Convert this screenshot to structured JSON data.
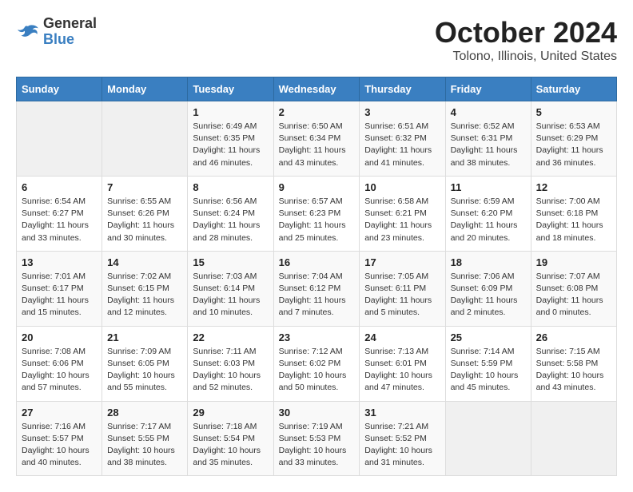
{
  "logo": {
    "general": "General",
    "blue": "Blue"
  },
  "title": "October 2024",
  "subtitle": "Tolono, Illinois, United States",
  "days_of_week": [
    "Sunday",
    "Monday",
    "Tuesday",
    "Wednesday",
    "Thursday",
    "Friday",
    "Saturday"
  ],
  "weeks": [
    [
      {
        "day": "",
        "info": ""
      },
      {
        "day": "",
        "info": ""
      },
      {
        "day": "1",
        "info": "Sunrise: 6:49 AM\nSunset: 6:35 PM\nDaylight: 11 hours and 46 minutes."
      },
      {
        "day": "2",
        "info": "Sunrise: 6:50 AM\nSunset: 6:34 PM\nDaylight: 11 hours and 43 minutes."
      },
      {
        "day": "3",
        "info": "Sunrise: 6:51 AM\nSunset: 6:32 PM\nDaylight: 11 hours and 41 minutes."
      },
      {
        "day": "4",
        "info": "Sunrise: 6:52 AM\nSunset: 6:31 PM\nDaylight: 11 hours and 38 minutes."
      },
      {
        "day": "5",
        "info": "Sunrise: 6:53 AM\nSunset: 6:29 PM\nDaylight: 11 hours and 36 minutes."
      }
    ],
    [
      {
        "day": "6",
        "info": "Sunrise: 6:54 AM\nSunset: 6:27 PM\nDaylight: 11 hours and 33 minutes."
      },
      {
        "day": "7",
        "info": "Sunrise: 6:55 AM\nSunset: 6:26 PM\nDaylight: 11 hours and 30 minutes."
      },
      {
        "day": "8",
        "info": "Sunrise: 6:56 AM\nSunset: 6:24 PM\nDaylight: 11 hours and 28 minutes."
      },
      {
        "day": "9",
        "info": "Sunrise: 6:57 AM\nSunset: 6:23 PM\nDaylight: 11 hours and 25 minutes."
      },
      {
        "day": "10",
        "info": "Sunrise: 6:58 AM\nSunset: 6:21 PM\nDaylight: 11 hours and 23 minutes."
      },
      {
        "day": "11",
        "info": "Sunrise: 6:59 AM\nSunset: 6:20 PM\nDaylight: 11 hours and 20 minutes."
      },
      {
        "day": "12",
        "info": "Sunrise: 7:00 AM\nSunset: 6:18 PM\nDaylight: 11 hours and 18 minutes."
      }
    ],
    [
      {
        "day": "13",
        "info": "Sunrise: 7:01 AM\nSunset: 6:17 PM\nDaylight: 11 hours and 15 minutes."
      },
      {
        "day": "14",
        "info": "Sunrise: 7:02 AM\nSunset: 6:15 PM\nDaylight: 11 hours and 12 minutes."
      },
      {
        "day": "15",
        "info": "Sunrise: 7:03 AM\nSunset: 6:14 PM\nDaylight: 11 hours and 10 minutes."
      },
      {
        "day": "16",
        "info": "Sunrise: 7:04 AM\nSunset: 6:12 PM\nDaylight: 11 hours and 7 minutes."
      },
      {
        "day": "17",
        "info": "Sunrise: 7:05 AM\nSunset: 6:11 PM\nDaylight: 11 hours and 5 minutes."
      },
      {
        "day": "18",
        "info": "Sunrise: 7:06 AM\nSunset: 6:09 PM\nDaylight: 11 hours and 2 minutes."
      },
      {
        "day": "19",
        "info": "Sunrise: 7:07 AM\nSunset: 6:08 PM\nDaylight: 11 hours and 0 minutes."
      }
    ],
    [
      {
        "day": "20",
        "info": "Sunrise: 7:08 AM\nSunset: 6:06 PM\nDaylight: 10 hours and 57 minutes."
      },
      {
        "day": "21",
        "info": "Sunrise: 7:09 AM\nSunset: 6:05 PM\nDaylight: 10 hours and 55 minutes."
      },
      {
        "day": "22",
        "info": "Sunrise: 7:11 AM\nSunset: 6:03 PM\nDaylight: 10 hours and 52 minutes."
      },
      {
        "day": "23",
        "info": "Sunrise: 7:12 AM\nSunset: 6:02 PM\nDaylight: 10 hours and 50 minutes."
      },
      {
        "day": "24",
        "info": "Sunrise: 7:13 AM\nSunset: 6:01 PM\nDaylight: 10 hours and 47 minutes."
      },
      {
        "day": "25",
        "info": "Sunrise: 7:14 AM\nSunset: 5:59 PM\nDaylight: 10 hours and 45 minutes."
      },
      {
        "day": "26",
        "info": "Sunrise: 7:15 AM\nSunset: 5:58 PM\nDaylight: 10 hours and 43 minutes."
      }
    ],
    [
      {
        "day": "27",
        "info": "Sunrise: 7:16 AM\nSunset: 5:57 PM\nDaylight: 10 hours and 40 minutes."
      },
      {
        "day": "28",
        "info": "Sunrise: 7:17 AM\nSunset: 5:55 PM\nDaylight: 10 hours and 38 minutes."
      },
      {
        "day": "29",
        "info": "Sunrise: 7:18 AM\nSunset: 5:54 PM\nDaylight: 10 hours and 35 minutes."
      },
      {
        "day": "30",
        "info": "Sunrise: 7:19 AM\nSunset: 5:53 PM\nDaylight: 10 hours and 33 minutes."
      },
      {
        "day": "31",
        "info": "Sunrise: 7:21 AM\nSunset: 5:52 PM\nDaylight: 10 hours and 31 minutes."
      },
      {
        "day": "",
        "info": ""
      },
      {
        "day": "",
        "info": ""
      }
    ]
  ]
}
